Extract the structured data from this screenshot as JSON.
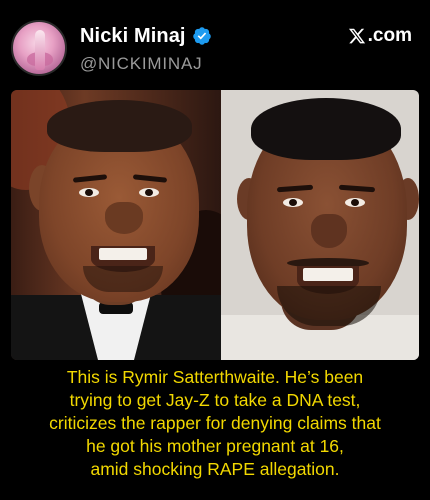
{
  "post": {
    "author_name": "Nicki Minaj",
    "handle": "@NICKIMINAJ",
    "brand": ".com",
    "brand_icon": "x-logo-icon",
    "verified_icon": "verified-badge-icon",
    "verified_color": "#1d9bf0"
  },
  "image": {
    "left_subject": "Jay-Z photo",
    "right_subject": "Rymir Satterthwaite photo"
  },
  "caption": {
    "lines": [
      "This is Rymir Satterthwaite. He’s been",
      "trying to get Jay-Z to take a DNA test,",
      "criticizes the rapper for denying claims that",
      "he got his mother pregnant at 16,",
      "amid shocking RAPE allegation."
    ],
    "color": "#f2d800"
  }
}
